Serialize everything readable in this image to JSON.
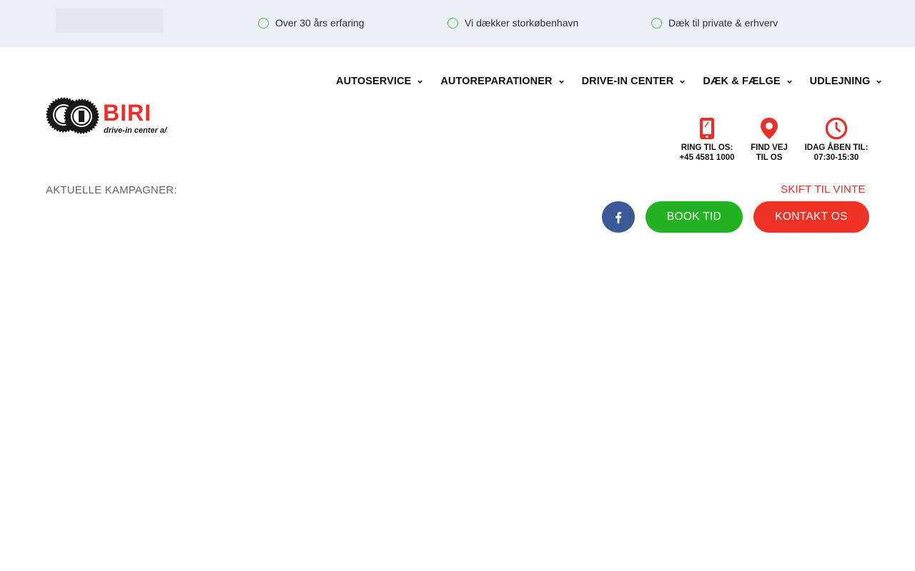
{
  "topbar": {
    "usps": [
      "Over 30 års erfaring",
      "Vi dækker storkøbenhavn",
      "Dæk til private & erhverv"
    ]
  },
  "logo": {
    "brand": "BIRI",
    "tagline": "drive-in center a/s"
  },
  "nav": {
    "items": [
      {
        "label": "AUTOSERVICE"
      },
      {
        "label": "AUTOREPARATIONER"
      },
      {
        "label": "DRIVE-IN CENTER"
      },
      {
        "label": "DÆK & FÆLGE"
      },
      {
        "label": "UDLEJNING"
      }
    ]
  },
  "info": {
    "phone": {
      "label": "RING TIL OS:",
      "value": "+45 4581 1000",
      "icon": "phone-icon"
    },
    "directions": {
      "label": "FIND VEJ",
      "value": "TIL OS",
      "icon": "map-pin-icon"
    },
    "hours": {
      "label": "IDAG ÅBEN TIL:",
      "value": "07:30-15:30",
      "icon": "clock-icon"
    }
  },
  "campaign": {
    "label": "AKTUELLE KAMPAGNER:",
    "ticker": "SKIFT TIL VINTE"
  },
  "cta": {
    "book": "BOOK TID",
    "contact": "KONTAKT OS"
  },
  "colors": {
    "accent_red": "#ee3326",
    "accent_green": "#22b222",
    "facebook_blue": "#3b5998",
    "check_green": "#3fbd3f",
    "topbar_bg": "#ebeef5"
  }
}
